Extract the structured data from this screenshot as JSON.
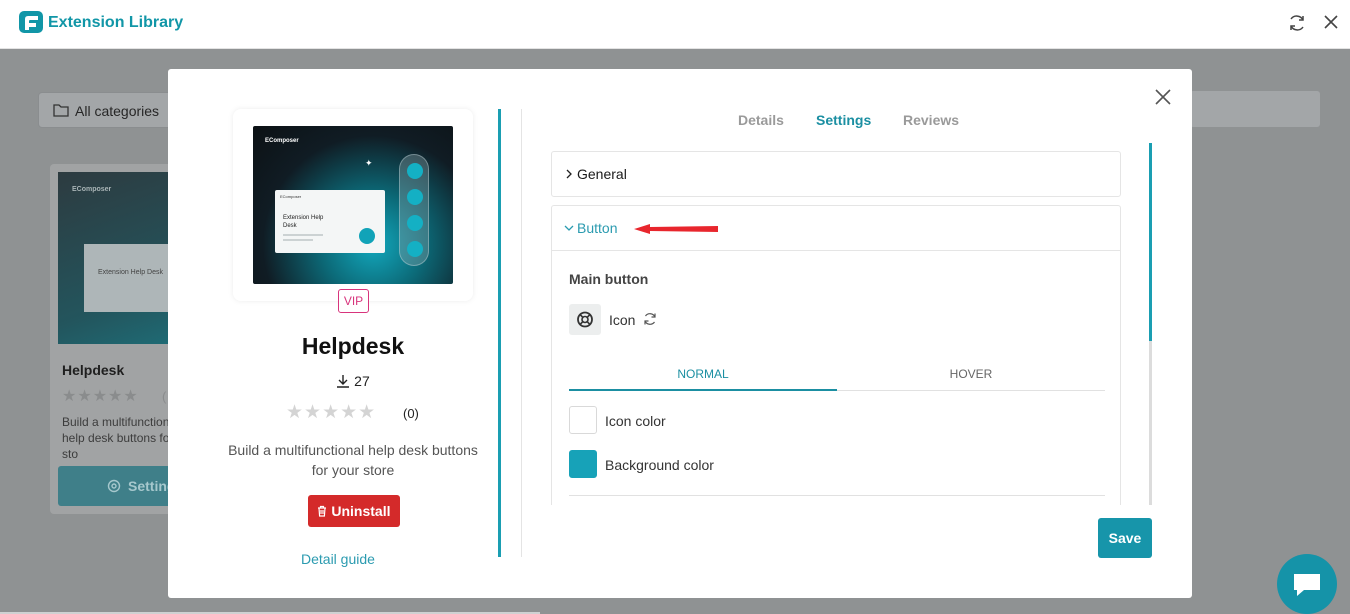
{
  "app": {
    "title": "Extension Library"
  },
  "background": {
    "category_filter": "All categories",
    "card": {
      "brand": "EComposer",
      "preview_text": "Extension Help Desk",
      "title": "Helpdesk",
      "stars": "★★★★★",
      "rating": "(",
      "description": "Build a multifunctional help desk buttons for your sto",
      "button_label": "Setting"
    }
  },
  "modal": {
    "preview": {
      "brand": "EComposer",
      "window_brand": "EComposer",
      "heading": "Extension Help Desk"
    },
    "badge": "VIP",
    "name": "Helpdesk",
    "downloads": "27",
    "rating": {
      "stars": 0,
      "max": 5,
      "count_text": "(0)"
    },
    "description": "Build a multifunctional help desk buttons for your store",
    "uninstall_label": "Uninstall",
    "detail_guide_label": "Detail guide",
    "tabs": [
      {
        "label": "Details",
        "active": false
      },
      {
        "label": "Settings",
        "active": true
      },
      {
        "label": "Reviews",
        "active": false
      }
    ],
    "sections": {
      "general": {
        "title": "General",
        "expanded": false
      },
      "button": {
        "title": "Button",
        "expanded": true,
        "main_button_heading": "Main button",
        "icon_label": "Icon",
        "states": [
          {
            "label": "NORMAL",
            "active": true
          },
          {
            "label": "HOVER",
            "active": false
          }
        ],
        "colors": [
          {
            "label": "Icon color",
            "value": "#ffffff"
          },
          {
            "label": "Background color",
            "value": "#17a2b8"
          }
        ]
      }
    },
    "save_label": "Save"
  },
  "colors": {
    "accent": "#1795aa",
    "danger": "#d42a2a",
    "vip": "#d8347c",
    "annotation_arrow": "#e8262d"
  }
}
